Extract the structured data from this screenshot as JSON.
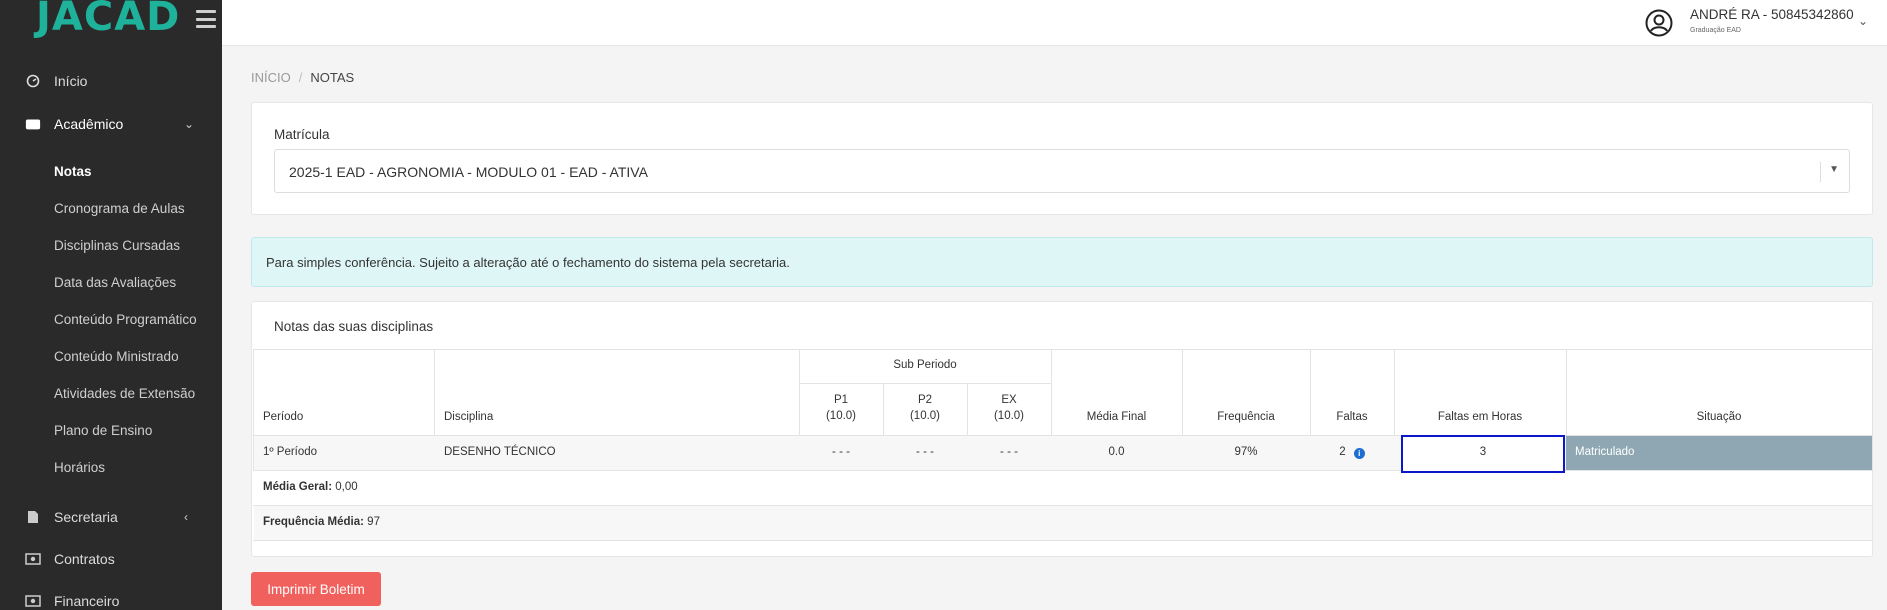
{
  "app": {
    "logo": "JACAD"
  },
  "sidebar": {
    "items": [
      {
        "label": "Início",
        "icon": "dashboard-icon"
      },
      {
        "label": "Acadêmico",
        "icon": "graduation-icon"
      },
      {
        "label": "Secretaria",
        "icon": "document-icon"
      },
      {
        "label": "Contratos",
        "icon": "money-icon"
      },
      {
        "label": "Financeiro",
        "icon": "money-icon"
      }
    ],
    "sub_items": [
      "Notas",
      "Cronograma de Aulas",
      "Disciplinas Cursadas",
      "Data das Avaliações",
      "Conteúdo Programático",
      "Conteúdo Ministrado",
      "Atividades de Extensão",
      "Plano de Ensino",
      "Horários"
    ]
  },
  "header": {
    "user_name": "ANDRÉ RA - 50845342860",
    "user_sub": "Graduação EAD"
  },
  "breadcrumb": {
    "home": "INÍCIO",
    "current": "NOTAS"
  },
  "matricula": {
    "label": "Matrícula",
    "selected": "2025-1 EAD - AGRONOMIA - MODULO 01 - EAD - ATIVA"
  },
  "alert": {
    "text": "Para simples conferência. Sujeito a alteração até o fechamento do sistema pela secretaria."
  },
  "grades": {
    "title": "Notas das suas disciplinas",
    "headers": {
      "periodo": "Período",
      "disciplina": "Disciplina",
      "sub_periodo": "Sub Periodo",
      "p1": "P1",
      "p1_max": "(10.0)",
      "p2": "P2",
      "p2_max": "(10.0)",
      "ex": "EX",
      "ex_max": "(10.0)",
      "media_final": "Média Final",
      "frequencia": "Frequência",
      "faltas": "Faltas",
      "faltas_horas": "Faltas em Horas",
      "situacao": "Situação"
    },
    "row": {
      "periodo": "1º Período",
      "disciplina": "DESENHO TÉCNICO",
      "p1": "- - -",
      "p2": "- - -",
      "ex": "- - -",
      "media_final": "0.0",
      "frequencia": "97%",
      "faltas": "2",
      "faltas_horas": "3",
      "situacao": "Matriculado"
    },
    "media_geral_label": "Média Geral:",
    "media_geral_value": "0,00",
    "frequencia_media_label": "Frequência Média:",
    "frequencia_media_value": "97"
  },
  "actions": {
    "print_label": "Imprimir Boletim"
  },
  "colors": {
    "sidebar_bg": "#2a2a2a",
    "brand": "#1fb29b",
    "situacao_bg": "#8fa7b3",
    "alert_bg": "#dff6f6",
    "print_btn": "#f0605d",
    "highlight": "#0a18c9"
  }
}
